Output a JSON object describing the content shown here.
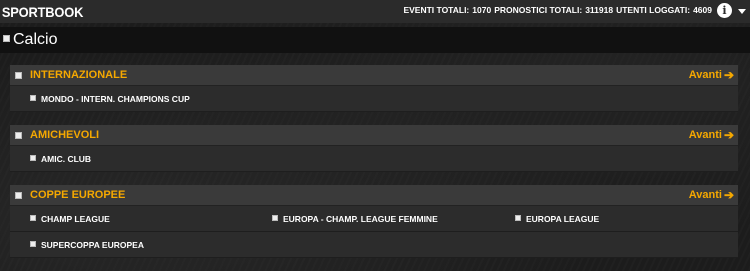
{
  "header": {
    "brand": "SPORTBOOK",
    "stats": {
      "eventi_label": "EVENTI TOTALI:",
      "eventi_value": "1070",
      "pronostici_label": "PRONOSTICI TOTALI:",
      "pronostici_value": "311918",
      "utenti_label": "UTENTI LOGGATI:",
      "utenti_value": "4609"
    },
    "info_icon": "info-icon",
    "menu_icon": "caret-down-icon"
  },
  "sport": {
    "title": "Calcio"
  },
  "groups": [
    {
      "title": "INTERNAZIONALE",
      "next_label": "Avanti",
      "items": [
        "MONDO - INTERN. CHAMPIONS CUP"
      ]
    },
    {
      "title": "AMICHEVOLI",
      "next_label": "Avanti",
      "items": [
        "AMIC. CLUB"
      ]
    },
    {
      "title": "COPPE EUROPEE",
      "next_label": "Avanti",
      "items": [
        "CHAMP LEAGUE",
        "EUROPA - CHAMP. LEAGUE FEMMINE",
        "EUROPA LEAGUE",
        "SUPERCOPPA EUROPEA"
      ]
    }
  ],
  "colors": {
    "accent": "#f5a800",
    "bar": "#2b2b2b",
    "group_header": "#3a3a3a",
    "row": "#2c2c2c"
  }
}
